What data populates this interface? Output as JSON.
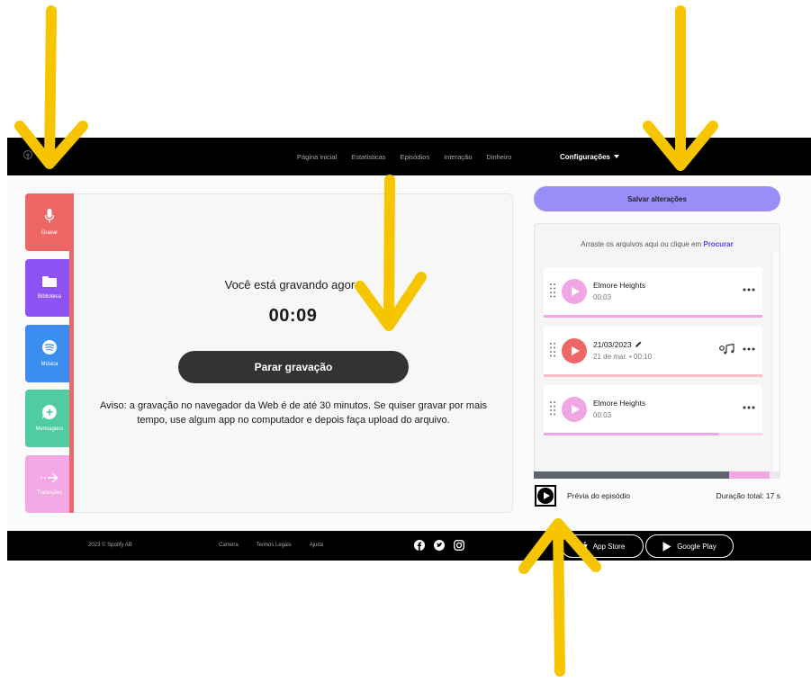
{
  "nav": {
    "links": [
      "Página inicial",
      "Estatísticas",
      "Episódios",
      "Interação",
      "Dinheiro"
    ],
    "settings_label": "Configurações",
    "icons": {
      "logo": "podcast-logo-icon",
      "settings_caret": "caret-down-icon"
    }
  },
  "tools": [
    {
      "label": "Gravar",
      "icon": "microphone-icon",
      "color": "#ee6767",
      "active": true
    },
    {
      "label": "Biblioteca",
      "icon": "folder-icon",
      "color": "#8f52f5"
    },
    {
      "label": "Música",
      "icon": "spotify-icon",
      "color": "#3b8ef0"
    },
    {
      "label": "Mensagens",
      "icon": "message-plus-icon",
      "color": "#4fcca2"
    },
    {
      "label": "Transições",
      "icon": "arrow-right-icon",
      "color": "#f2a8e4"
    }
  ],
  "recorder": {
    "heading": "Você está gravando agora",
    "timer": "00:09",
    "stop_label": "Parar gravação",
    "notice": "Aviso: a gravação no navegador da Web é de até 30 minutos. Se quiser gravar por mais tempo, use algum app no computador e depois faça upload do arquivo."
  },
  "editor": {
    "save_label": "Salvar alterações",
    "drop_text": "Arraste os arquivos aqui ou clique em",
    "drop_link": "Procurar",
    "segments": [
      {
        "title": "Elmore Heights",
        "meta": "00:03",
        "play_color": "#f0a6e2",
        "bar_color": "#f0a6e2",
        "bar_progress": 1.0
      },
      {
        "title": "21/03/2023",
        "meta": "21 de mar. • 00:10",
        "play_color": "#ee6767",
        "bar_color": "#f6c1c1",
        "bar_progress": 1.0
      },
      {
        "title": "Elmore Heights",
        "meta": "00:03",
        "play_color": "#f0a6e2",
        "bar_color": "#f0a6e2",
        "bar_progress": 0.8
      }
    ],
    "preview_label": "Prévia do episódio",
    "total_duration": "Duração total: 17 s"
  },
  "footer": {
    "copyright": "2023 © Spotify AB",
    "links": [
      "Carreira",
      "Termos Legais",
      "Ajuda"
    ],
    "social_icons": [
      "facebook-icon",
      "twitter-icon",
      "instagram-icon"
    ],
    "app_store": "App Store",
    "google_play": "Google Play"
  },
  "annotation_color": "#f7c500"
}
